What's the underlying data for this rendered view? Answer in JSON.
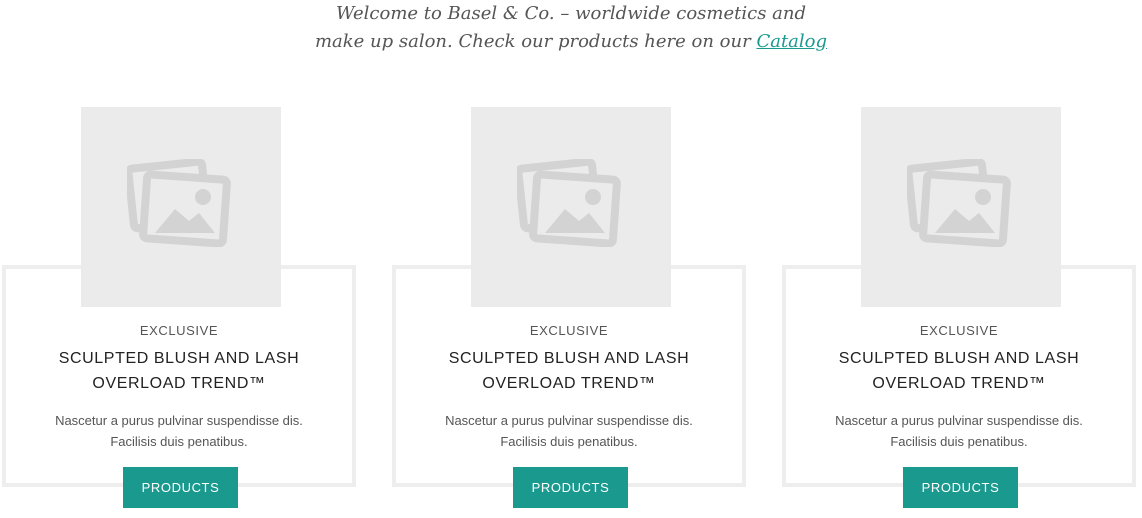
{
  "intro": {
    "line1": "Welcome to Basel & Co. – worldwide cosmetics and",
    "line2_prefix": "make up salon. Check our products here on our ",
    "catalog_link": "Catalog"
  },
  "cards": [
    {
      "kicker": "EXCLUSIVE",
      "title_line1": "SCULPTED BLUSH AND LASH",
      "title_line2": "OVERLOAD TREND™",
      "desc_line1": "Nascetur a purus pulvinar suspendisse dis.",
      "desc_line2": "Facilisis duis penatibus.",
      "button": "PRODUCTS",
      "image_icon": "image-placeholder-icon"
    },
    {
      "kicker": "EXCLUSIVE",
      "title_line1": "SCULPTED BLUSH AND LASH",
      "title_line2": "OVERLOAD TREND™",
      "desc_line1": "Nascetur a purus pulvinar suspendisse dis.",
      "desc_line2": "Facilisis duis penatibus.",
      "button": "PRODUCTS",
      "image_icon": "image-placeholder-icon"
    },
    {
      "kicker": "EXCLUSIVE",
      "title_line1": "SCULPTED BLUSH AND LASH",
      "title_line2": "OVERLOAD TREND™",
      "desc_line1": "Nascetur a purus pulvinar suspendisse dis.",
      "desc_line2": "Facilisis duis penatibus.",
      "button": "PRODUCTS",
      "image_icon": "image-placeholder-icon"
    }
  ],
  "colors": {
    "accent": "#1a9a8f",
    "card_border": "#eeeeee",
    "image_bg": "#ebebeb",
    "placeholder_icon": "#d3d3d3"
  }
}
